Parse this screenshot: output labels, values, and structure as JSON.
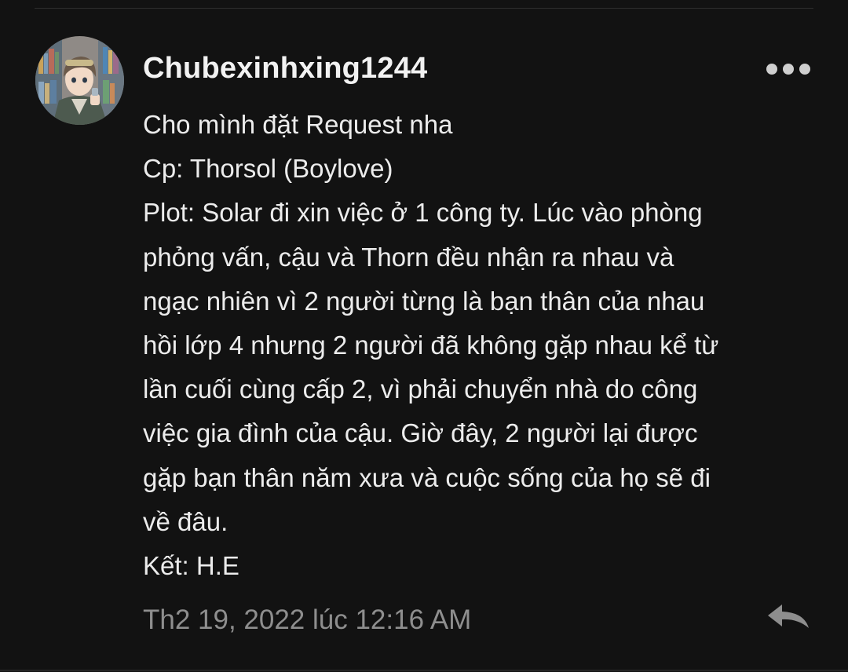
{
  "comment": {
    "username": "Chubexinhxing1244",
    "lines": [
      "Cho mình đặt Request nha",
      "Cp: Thorsol (Boylove)",
      "Plot: Solar đi xin việc ở 1 công ty. Lúc vào phòng",
      "phỏng vấn, cậu và Thorn đều nhận ra nhau và",
      "ngạc nhiên vì 2 người từng là bạn thân của nhau",
      "hồi lớp 4 nhưng 2 người đã không gặp nhau kể từ",
      "lần cuối cùng cấp 2, vì phải chuyển nhà do công",
      "việc gia đình của cậu. Giờ đây, 2 người lại được",
      "gặp bạn thân năm xưa và cuộc sống của họ sẽ đi",
      "về đâu.",
      "Kết: H.E"
    ],
    "timestamp": "Th2 19, 2022 lúc 12:16 AM"
  },
  "icons": {
    "more": "more-horizontal-icon",
    "reply": "reply-arrow-icon"
  },
  "colors": {
    "background": "#121212",
    "username": "#f2f2f2",
    "text": "#ececec",
    "timestamp": "#8e8e8e",
    "icon": "#cfcfcf"
  }
}
